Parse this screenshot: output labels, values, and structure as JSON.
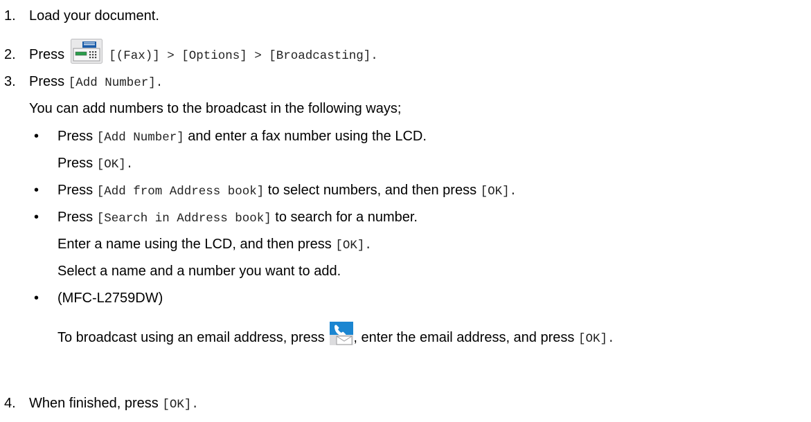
{
  "steps": [
    {
      "number": "1.",
      "text": "Load your document."
    },
    {
      "number": "2.",
      "prefix": "Press",
      "icon": "fax-icon",
      "code": "[(Fax)] > [Options] > [Broadcasting]."
    },
    {
      "number": "3.",
      "prefix": "Press",
      "code": "[Add Number].",
      "note": "You can add numbers to the broadcast in the following ways;",
      "bullets": [
        {
          "prefix": "Press",
          "code": "[Add Number]",
          "text": "and enter a fax number using the LCD.",
          "sub": [
            {
              "prefix": "Press",
              "code": "[OK]."
            }
          ]
        },
        {
          "prefix": "Press",
          "code": "[Add from Address book]",
          "text": "to select numbers, and then press",
          "code2": "[OK]."
        },
        {
          "prefix": "Press",
          "code": "[Search in Address book]",
          "text": "to search for a number.",
          "sub": [
            {
              "prefix": "Enter a name using the LCD, and then press",
              "code": "[OK]."
            },
            {
              "prefix": "Select a name and a number you want to add."
            }
          ]
        },
        {
          "text": "(MFC-L2759DW)",
          "sub": [
            {
              "prefix": "To broadcast using an email address, press",
              "icon": "phone-email-icon",
              "text": ", enter the email address, and press",
              "code": "[OK]."
            }
          ]
        }
      ]
    },
    {
      "number": "4.",
      "prefix": "When finished, press",
      "code": "[OK]."
    }
  ],
  "colors": {
    "text": "#000000",
    "code": "#222222",
    "fax_icon_bg": "#e9e9ea",
    "fax_icon_blue": "#1a5ca8",
    "fax_icon_green": "#2a9d4a",
    "phone_icon_blue": "#1b86d1",
    "envelope_grey": "#c9c9cb"
  }
}
